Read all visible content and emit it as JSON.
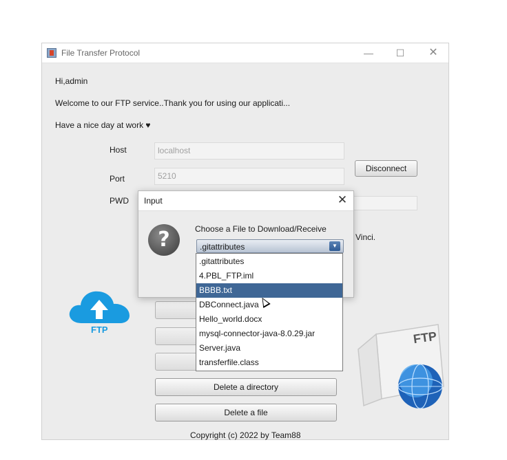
{
  "window": {
    "title": "File Transfer Protocol",
    "minimize_glyph": "—",
    "maximize_glyph": "☐",
    "close_glyph": "✕"
  },
  "greeting": "Hi,admin",
  "welcome": "Welcome to our FTP service..Thank you for using our applicati...",
  "nice_day": "Have a nice day at work ♥",
  "connection": {
    "host_label": "Host",
    "host_value": "localhost",
    "port_label": "Port",
    "port_value": "5210",
    "pwd_label": "PWD",
    "disconnect_label": "Disconnect",
    "partial_text": "Vinci."
  },
  "dialog": {
    "title": "Input",
    "close_glyph": "✕",
    "message": "Choose a File to Download/Receive",
    "selected_value": ".gitattributes",
    "options": [
      ".gitattributes",
      "4.PBL_FTP.iml",
      "BBBB.txt",
      "DBConnect.java",
      "Hello_world.docx",
      "mysql-connector-java-8.0.29.jar",
      "Server.java",
      "transferfile.class"
    ],
    "highlighted_option": "BBBB.txt"
  },
  "actions": {
    "delete_directory": "Delete a directory",
    "delete_file": "Delete a file"
  },
  "logo_ftp_label": "FTP",
  "doc_icon_label": "FTP",
  "copyright": "Copyright (c) 2022 by Team88",
  "colors": {
    "accent_blue": "#1a9be0",
    "selection": "#3f6796"
  },
  "icons": [
    "app-java-icon",
    "question-icon",
    "cloud-upload-icon",
    "ftp-globe-document-icon",
    "mouse-cursor"
  ]
}
